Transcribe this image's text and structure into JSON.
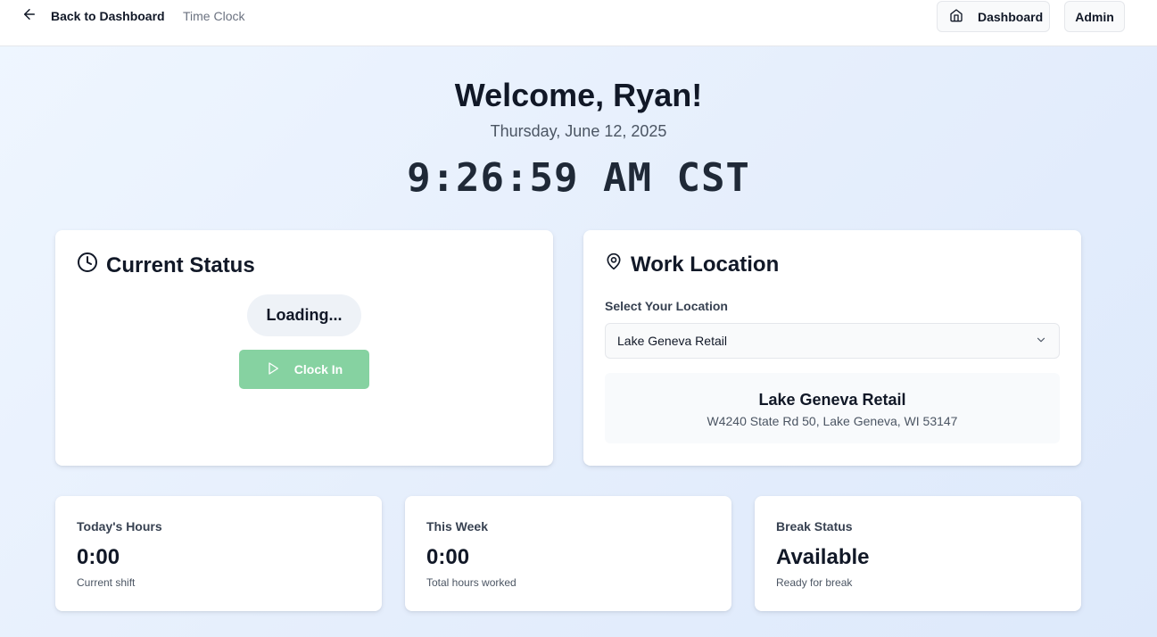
{
  "header": {
    "back_label": "Back to Dashboard",
    "breadcrumb": "Time Clock",
    "dashboard_label": "Dashboard",
    "admin_label": "Admin"
  },
  "hero": {
    "welcome": "Welcome, Ryan!",
    "date": "Thursday, June 12, 2025",
    "time": "9:26:59 AM CST"
  },
  "status_card": {
    "title": "Current Status",
    "status_text": "Loading...",
    "clock_in_label": "Clock In"
  },
  "location_card": {
    "title": "Work Location",
    "select_label": "Select Your Location",
    "selected_value": "Lake Geneva Retail",
    "location_name": "Lake Geneva Retail",
    "location_address": "W4240 State Rd 50, Lake Geneva, WI 53147"
  },
  "stats": [
    {
      "label": "Today's Hours",
      "value": "0:00",
      "sub": "Current shift"
    },
    {
      "label": "This Week",
      "value": "0:00",
      "sub": "Total hours worked"
    },
    {
      "label": "Break Status",
      "value": "Available",
      "sub": "Ready for break"
    }
  ],
  "icons": {
    "back": "arrow-left-icon",
    "dashboard": "home-icon",
    "status": "clock-icon",
    "location": "map-pin-icon",
    "clock_in": "play-icon",
    "select": "chevron-down-icon"
  },
  "colors": {
    "clock_in_button": "#86d2a1",
    "status_pill": "#eef2f7"
  }
}
